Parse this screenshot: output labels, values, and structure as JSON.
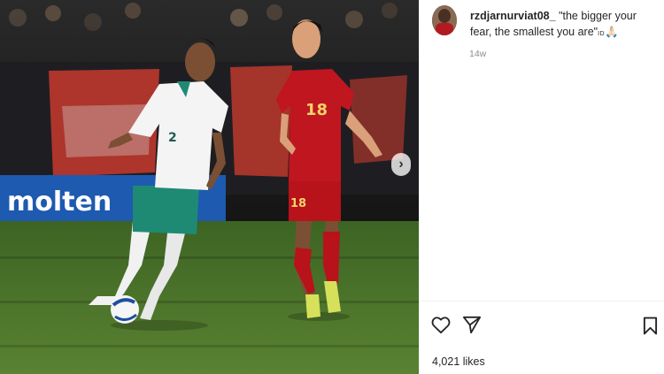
{
  "post": {
    "username": "rzdjarnurviat08_",
    "caption": "\"the bigger your fear, the smallest you are\"",
    "caption_badge": "ID",
    "caption_emoji": "🙏🏻",
    "timestamp": "14w",
    "likes": "4,021 likes"
  },
  "photo": {
    "banner_text": "molten",
    "player_left_number": "2",
    "player_right_number": "18",
    "player_right_shorts_number": "18"
  },
  "icons": {
    "like": "heart-icon",
    "share": "send-icon",
    "save": "bookmark-icon",
    "next": "chevron-right-icon"
  },
  "colors": {
    "text": "#262626",
    "muted": "#8e8e8e",
    "divider": "#efefef",
    "red_kit": "#b8121b",
    "white_kit": "#f4f4f4",
    "teal_shorts": "#1f8a74",
    "pitch": "#4f7a2c"
  }
}
